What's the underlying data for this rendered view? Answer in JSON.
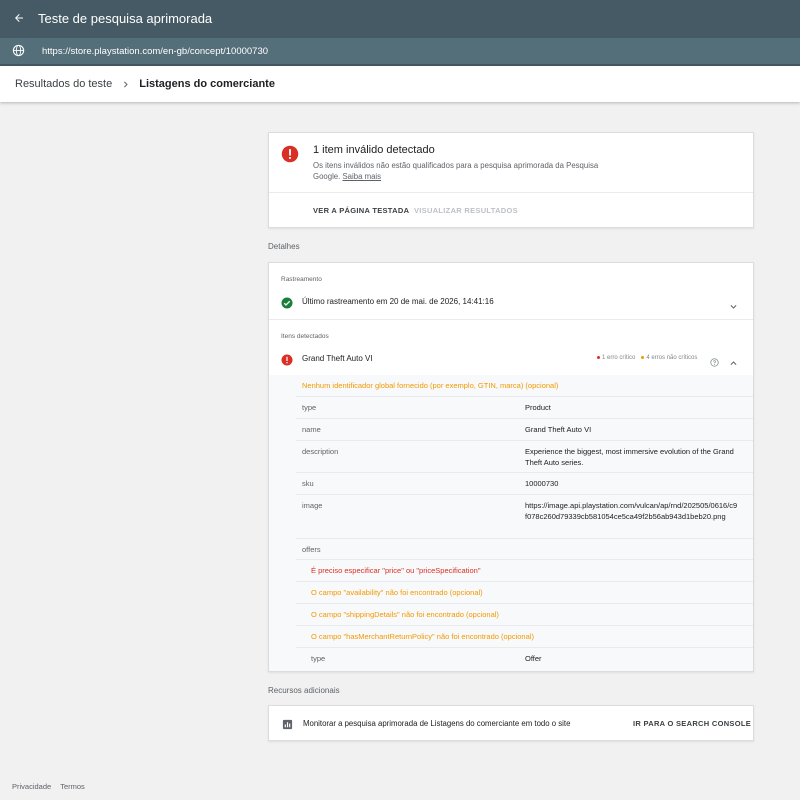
{
  "app": {
    "title": "Teste de pesquisa aprimorada",
    "url": "https://store.playstation.com/en-gb/concept/10000730"
  },
  "breadcrumb": {
    "parent": "Resultados do teste",
    "current": "Listagens do comerciante"
  },
  "summary": {
    "title": "1 item inválido detectado",
    "description": "Os itens inválidos não estão qualificados para a pesquisa aprimorada da Pesquisa Google.",
    "learn_more": "Saiba mais",
    "view_page_button": "VER A PÁGINA TESTADA",
    "view_results_button": "VISUALIZAR RESULTADOS"
  },
  "details": {
    "section_label": "Detalhes",
    "crawl_label": "Rastreamento",
    "crawl_status": "Último rastreamento em 20 de mai. de 2026, 14:41:16",
    "items_label": "Itens detectados",
    "item": {
      "name": "Grand Theft Auto VI",
      "critical_errors": "1 erro crítico",
      "noncritical_errors": "4 erros não críticos"
    },
    "global_id_warning": "Nenhum identificador global fornecido (por exemplo, GTIN, marca) (opcional)",
    "properties": [
      {
        "key": "type",
        "value": "Product"
      },
      {
        "key": "name",
        "value": "Grand Theft Auto VI"
      },
      {
        "key": "description",
        "value": "Experience the biggest, most immersive evolution of the Grand Theft Auto series."
      },
      {
        "key": "sku",
        "value": "10000730"
      },
      {
        "key": "image",
        "value": "https://image.api.playstation.com/vulcan/ap/rnd/202505/0616/c9f078c260d79339cb581054ce5ca49f2b56ab943d1beb20.png"
      }
    ],
    "offers_label": "offers",
    "offer_issues": {
      "price_error": "É preciso especificar \"price\" ou \"priceSpecification\"",
      "availability_warning": "O campo \"availability\" não foi encontrado (opcional)",
      "shipping_warning": "O campo \"shippingDetails\" não foi encontrado (opcional)",
      "return_policy_warning": "O campo \"hasMerchantReturnPolicy\" não foi encontrado (opcional)"
    },
    "offer_type": {
      "key": "type",
      "value": "Offer"
    }
  },
  "resources": {
    "section_label": "Recursos adicionais",
    "text": "Monitorar a pesquisa aprimorada de Listagens do comerciante em todo o site",
    "link": "IR PARA O SEARCH CONSOLE"
  },
  "footer": {
    "privacy": "Privacidade",
    "terms": "Termos"
  },
  "colors": {
    "error": "#d93025",
    "warning": "#f29900",
    "success": "#188038",
    "header": "#455a64"
  },
  "icons": [
    "back-arrow-icon",
    "globe-icon",
    "chevron-right-icon",
    "error-icon",
    "check-circle-icon",
    "chevron-down-icon",
    "chevron-up-icon",
    "help-icon",
    "chart-icon"
  ]
}
